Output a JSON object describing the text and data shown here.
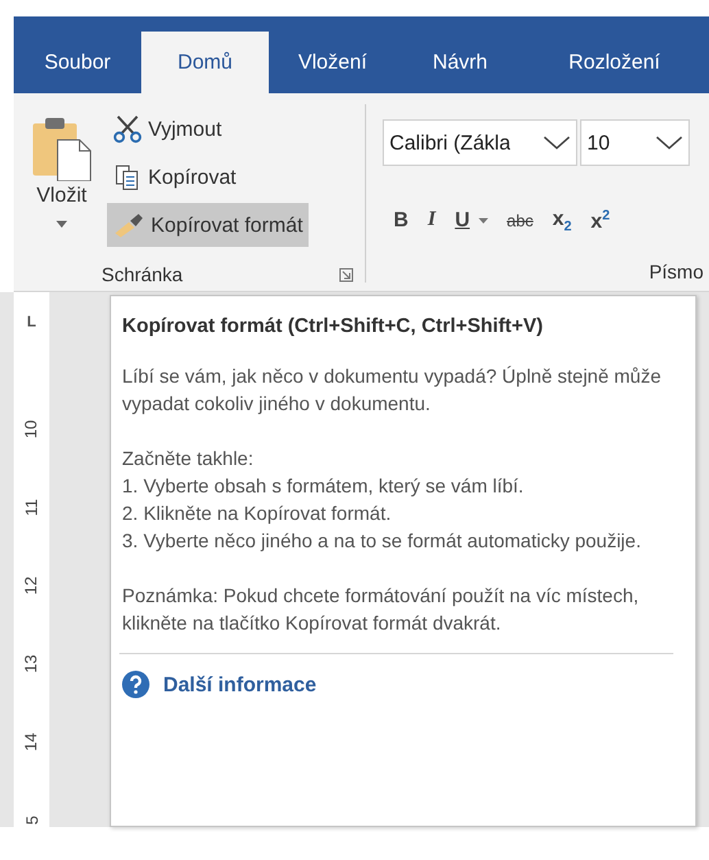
{
  "tabs": [
    {
      "label": "Soubor",
      "selected": false
    },
    {
      "label": "Domů",
      "selected": true
    },
    {
      "label": "Vložení",
      "selected": false
    },
    {
      "label": "Návrh",
      "selected": false
    },
    {
      "label": "Rozložení",
      "selected": false
    }
  ],
  "clipboard": {
    "paste": "Vložit",
    "cut": "Vyjmout",
    "copy": "Kopírovat",
    "format_painter": {
      "label": "Kopírovat formát",
      "selected": true
    },
    "group_label": "Schránka"
  },
  "font": {
    "family": "Calibri (Zákla",
    "size": "10",
    "buttons": [
      {
        "label": "B",
        "kind": "bold"
      },
      {
        "label": "I",
        "kind": "italic"
      },
      {
        "label": "U",
        "kind": "underline"
      },
      {
        "label": "abc",
        "kind": "strike"
      },
      {
        "label": "x",
        "mark": "2",
        "kind": "sub"
      },
      {
        "label": "x",
        "mark": "2",
        "kind": "sup"
      }
    ],
    "group_label": "Písmo"
  },
  "ruler": {
    "marker": "L",
    "numbers": [
      "10",
      "11",
      "12",
      "13",
      "14",
      "5"
    ]
  },
  "tooltip": {
    "title": "Kopírovat formát (Ctrl+Shift+C, Ctrl+Shift+V)",
    "paragraphs": [
      "Líbí se vám, jak něco v dokumentu vypadá? Úplně stejně může vypadat cokoliv jiného v dokumentu.",
      "Začněte takhle:",
      "1. Vyberte obsah s formátem, který se vám líbí.",
      "2. Klikněte na Kopírovat formát.",
      "3. Vyberte něco jiného a na to se formát automaticky použije.",
      "Poznámka: Pokud chcete formátování použít na víc místech, klikněte na tlačítko Kopírovat formát dvakrát."
    ],
    "link": "Další informace"
  }
}
